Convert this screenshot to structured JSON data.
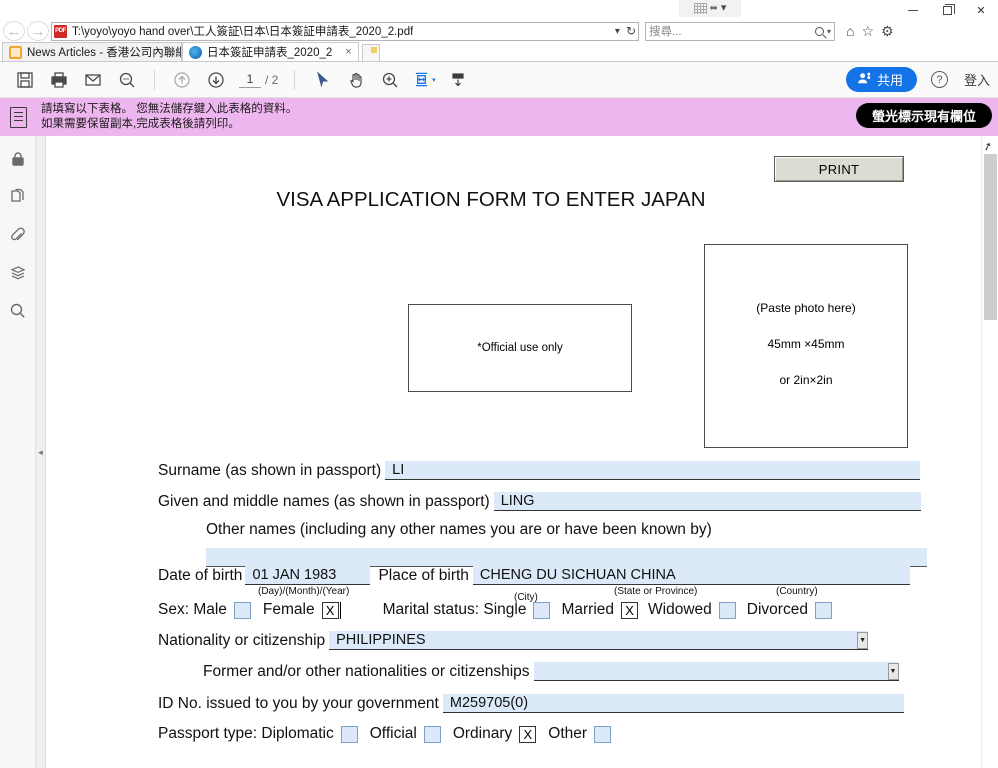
{
  "window": {
    "minimize": "minimize",
    "maximize": "restore",
    "close": "close",
    "snap_grid_icon": "grid-icon",
    "snap_expand_icon": "expand-icon",
    "snap_chevron_icon": "chevron-down-icon"
  },
  "address_bar": {
    "back_icon": "back-arrow-icon",
    "forward_icon": "forward-arrow-icon",
    "file_type_badge": "PDF",
    "url": "T:\\yoyo\\yoyo hand over\\工人簽証\\日本\\日本簽証申請表_2020_2.pdf",
    "url_dropdown_icon": "chevron-down-icon",
    "refresh_icon": "refresh-icon",
    "search_placeholder": "搜尋...",
    "search_value": "",
    "search_icon": "search-icon",
    "search_dropdown_icon": "chevron-down-icon",
    "home_icon": "home-icon",
    "favorites_icon": "star-icon",
    "settings_icon": "gear-icon"
  },
  "tabs": [
    {
      "title": "News Articles - 香港公司內聯網",
      "favicon": "news-favicon",
      "active": false,
      "closable": false
    },
    {
      "title": "日本簽証申請表_2020_2",
      "favicon": "ie-favicon",
      "active": true,
      "closable": true,
      "close_label": "×"
    }
  ],
  "new_tab_label": "new-tab",
  "toolbar": {
    "save_icon": "save-icon",
    "print_icon": "print-icon",
    "email_icon": "email-icon",
    "find_icon": "find-icon",
    "prev_page_icon": "arrow-up-icon",
    "next_page_icon": "arrow-down-icon",
    "page_current": "1",
    "page_total": "/ 2",
    "select_tool_icon": "cursor-arrow-icon",
    "hand_tool_icon": "hand-icon",
    "zoom_in_icon": "zoom-in-icon",
    "fit_page_icon": "fit-page-icon",
    "fit_page_dropdown_icon": "chevron-down-icon",
    "scroll_mode_icon": "scroll-down-icon",
    "share_label": "共用",
    "share_icon": "share-person-icon",
    "share_color": "#1473e6",
    "help_label": "?",
    "signin_label": "登入"
  },
  "notice": {
    "icon": "form-document-icon",
    "line1": "請填寫以下表格。 您無法儲存鍵入此表格的資料。",
    "line2": "如果需要保留副本,完成表格後請列印。",
    "highlight_button": "螢光標示現有欄位",
    "background": "#eeb6ee"
  },
  "sidebar": {
    "items": [
      {
        "icon": "lock-icon",
        "label": "security"
      },
      {
        "icon": "pages-icon",
        "label": "page-thumbnails"
      },
      {
        "icon": "paperclip-icon",
        "label": "attachments"
      },
      {
        "icon": "layers-icon",
        "label": "layers"
      },
      {
        "icon": "search-icon",
        "label": "search"
      }
    ],
    "collapse_icon": "collapse-left-icon"
  },
  "document": {
    "print_button": "PRINT",
    "title": "VISA APPLICATION FORM TO ENTER JAPAN",
    "official_use_box": "*Official use only",
    "photo_box": {
      "line1": "(Paste photo here)",
      "line2": "45mm ×45mm",
      "line3": "or 2in×2in"
    },
    "fields": {
      "surname_label": "Surname (as shown in passport)",
      "surname_value": "LI",
      "given_names_label": "Given and middle names (as shown in passport)",
      "given_names_value": "LING",
      "other_names_label": "Other names (including any other names you are or have been known by)",
      "other_names_value": "",
      "dob_label": "Date of birth",
      "dob_value": "01 JAN 1983",
      "dob_note": "(Day)/(Month)/(Year)",
      "pob_label": "Place of birth",
      "pob_value": "CHENG DU SICHUAN CHINA",
      "pob_note_city": "(City)",
      "pob_note_state": "(State or Province)",
      "pob_note_country": "(Country)",
      "sex_label": "Sex: Male",
      "sex_male_checked": "",
      "sex_female_label": "Female",
      "sex_female_checked": "X",
      "marital_label": "Marital status: Single",
      "marital_single_checked": "",
      "marital_married_label": "Married",
      "marital_married_checked": "X",
      "marital_widowed_label": "Widowed",
      "marital_widowed_checked": "",
      "marital_divorced_label": "Divorced",
      "marital_divorced_checked": "",
      "nationality_label": "Nationality or citizenship",
      "nationality_value": "PHILIPPINES",
      "former_nationality_label": "Former and/or other nationalities or citizenships",
      "former_nationality_value": "",
      "id_no_label": "ID No. issued to you by your government",
      "id_no_value": "M259705(0)",
      "passport_type_label": "Passport type: Diplomatic",
      "passport_diplomatic_checked": "",
      "passport_official_label": "Official",
      "passport_official_checked": "",
      "passport_ordinary_label": "Ordinary",
      "passport_ordinary_checked": "X",
      "passport_other_label": "Other",
      "passport_other_checked": "",
      "field_background": "#dbe9f8"
    }
  }
}
